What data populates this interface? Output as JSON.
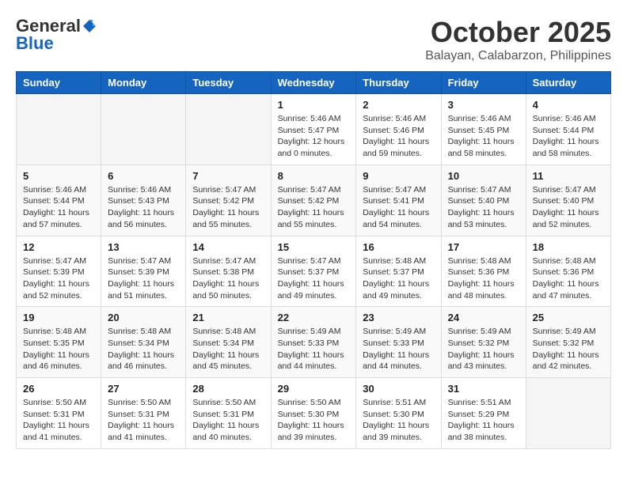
{
  "header": {
    "logo_general": "General",
    "logo_blue": "Blue",
    "month_year": "October 2025",
    "location": "Balayan, Calabarzon, Philippines"
  },
  "weekdays": [
    "Sunday",
    "Monday",
    "Tuesday",
    "Wednesday",
    "Thursday",
    "Friday",
    "Saturday"
  ],
  "weeks": [
    [
      {
        "day": "",
        "sunrise": "",
        "sunset": "",
        "daylight": ""
      },
      {
        "day": "",
        "sunrise": "",
        "sunset": "",
        "daylight": ""
      },
      {
        "day": "",
        "sunrise": "",
        "sunset": "",
        "daylight": ""
      },
      {
        "day": "1",
        "sunrise": "Sunrise: 5:46 AM",
        "sunset": "Sunset: 5:47 PM",
        "daylight": "Daylight: 12 hours and 0 minutes."
      },
      {
        "day": "2",
        "sunrise": "Sunrise: 5:46 AM",
        "sunset": "Sunset: 5:46 PM",
        "daylight": "Daylight: 11 hours and 59 minutes."
      },
      {
        "day": "3",
        "sunrise": "Sunrise: 5:46 AM",
        "sunset": "Sunset: 5:45 PM",
        "daylight": "Daylight: 11 hours and 58 minutes."
      },
      {
        "day": "4",
        "sunrise": "Sunrise: 5:46 AM",
        "sunset": "Sunset: 5:44 PM",
        "daylight": "Daylight: 11 hours and 58 minutes."
      }
    ],
    [
      {
        "day": "5",
        "sunrise": "Sunrise: 5:46 AM",
        "sunset": "Sunset: 5:44 PM",
        "daylight": "Daylight: 11 hours and 57 minutes."
      },
      {
        "day": "6",
        "sunrise": "Sunrise: 5:46 AM",
        "sunset": "Sunset: 5:43 PM",
        "daylight": "Daylight: 11 hours and 56 minutes."
      },
      {
        "day": "7",
        "sunrise": "Sunrise: 5:47 AM",
        "sunset": "Sunset: 5:42 PM",
        "daylight": "Daylight: 11 hours and 55 minutes."
      },
      {
        "day": "8",
        "sunrise": "Sunrise: 5:47 AM",
        "sunset": "Sunset: 5:42 PM",
        "daylight": "Daylight: 11 hours and 55 minutes."
      },
      {
        "day": "9",
        "sunrise": "Sunrise: 5:47 AM",
        "sunset": "Sunset: 5:41 PM",
        "daylight": "Daylight: 11 hours and 54 minutes."
      },
      {
        "day": "10",
        "sunrise": "Sunrise: 5:47 AM",
        "sunset": "Sunset: 5:40 PM",
        "daylight": "Daylight: 11 hours and 53 minutes."
      },
      {
        "day": "11",
        "sunrise": "Sunrise: 5:47 AM",
        "sunset": "Sunset: 5:40 PM",
        "daylight": "Daylight: 11 hours and 52 minutes."
      }
    ],
    [
      {
        "day": "12",
        "sunrise": "Sunrise: 5:47 AM",
        "sunset": "Sunset: 5:39 PM",
        "daylight": "Daylight: 11 hours and 52 minutes."
      },
      {
        "day": "13",
        "sunrise": "Sunrise: 5:47 AM",
        "sunset": "Sunset: 5:39 PM",
        "daylight": "Daylight: 11 hours and 51 minutes."
      },
      {
        "day": "14",
        "sunrise": "Sunrise: 5:47 AM",
        "sunset": "Sunset: 5:38 PM",
        "daylight": "Daylight: 11 hours and 50 minutes."
      },
      {
        "day": "15",
        "sunrise": "Sunrise: 5:47 AM",
        "sunset": "Sunset: 5:37 PM",
        "daylight": "Daylight: 11 hours and 49 minutes."
      },
      {
        "day": "16",
        "sunrise": "Sunrise: 5:48 AM",
        "sunset": "Sunset: 5:37 PM",
        "daylight": "Daylight: 11 hours and 49 minutes."
      },
      {
        "day": "17",
        "sunrise": "Sunrise: 5:48 AM",
        "sunset": "Sunset: 5:36 PM",
        "daylight": "Daylight: 11 hours and 48 minutes."
      },
      {
        "day": "18",
        "sunrise": "Sunrise: 5:48 AM",
        "sunset": "Sunset: 5:36 PM",
        "daylight": "Daylight: 11 hours and 47 minutes."
      }
    ],
    [
      {
        "day": "19",
        "sunrise": "Sunrise: 5:48 AM",
        "sunset": "Sunset: 5:35 PM",
        "daylight": "Daylight: 11 hours and 46 minutes."
      },
      {
        "day": "20",
        "sunrise": "Sunrise: 5:48 AM",
        "sunset": "Sunset: 5:34 PM",
        "daylight": "Daylight: 11 hours and 46 minutes."
      },
      {
        "day": "21",
        "sunrise": "Sunrise: 5:48 AM",
        "sunset": "Sunset: 5:34 PM",
        "daylight": "Daylight: 11 hours and 45 minutes."
      },
      {
        "day": "22",
        "sunrise": "Sunrise: 5:49 AM",
        "sunset": "Sunset: 5:33 PM",
        "daylight": "Daylight: 11 hours and 44 minutes."
      },
      {
        "day": "23",
        "sunrise": "Sunrise: 5:49 AM",
        "sunset": "Sunset: 5:33 PM",
        "daylight": "Daylight: 11 hours and 44 minutes."
      },
      {
        "day": "24",
        "sunrise": "Sunrise: 5:49 AM",
        "sunset": "Sunset: 5:32 PM",
        "daylight": "Daylight: 11 hours and 43 minutes."
      },
      {
        "day": "25",
        "sunrise": "Sunrise: 5:49 AM",
        "sunset": "Sunset: 5:32 PM",
        "daylight": "Daylight: 11 hours and 42 minutes."
      }
    ],
    [
      {
        "day": "26",
        "sunrise": "Sunrise: 5:50 AM",
        "sunset": "Sunset: 5:31 PM",
        "daylight": "Daylight: 11 hours and 41 minutes."
      },
      {
        "day": "27",
        "sunrise": "Sunrise: 5:50 AM",
        "sunset": "Sunset: 5:31 PM",
        "daylight": "Daylight: 11 hours and 41 minutes."
      },
      {
        "day": "28",
        "sunrise": "Sunrise: 5:50 AM",
        "sunset": "Sunset: 5:31 PM",
        "daylight": "Daylight: 11 hours and 40 minutes."
      },
      {
        "day": "29",
        "sunrise": "Sunrise: 5:50 AM",
        "sunset": "Sunset: 5:30 PM",
        "daylight": "Daylight: 11 hours and 39 minutes."
      },
      {
        "day": "30",
        "sunrise": "Sunrise: 5:51 AM",
        "sunset": "Sunset: 5:30 PM",
        "daylight": "Daylight: 11 hours and 39 minutes."
      },
      {
        "day": "31",
        "sunrise": "Sunrise: 5:51 AM",
        "sunset": "Sunset: 5:29 PM",
        "daylight": "Daylight: 11 hours and 38 minutes."
      },
      {
        "day": "",
        "sunrise": "",
        "sunset": "",
        "daylight": ""
      }
    ]
  ]
}
